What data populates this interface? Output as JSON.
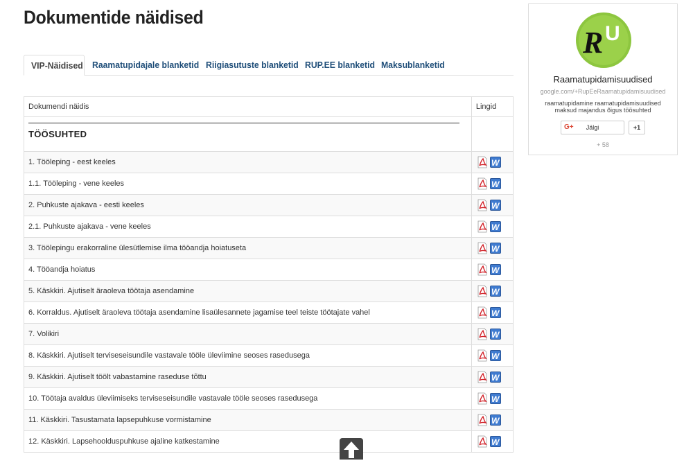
{
  "page": {
    "title": "Dokumentide näidised"
  },
  "tabs": [
    {
      "label": "VIP-Näidised",
      "active": true
    },
    {
      "label": "Raamatupidajale blanketid",
      "active": false
    },
    {
      "label": "Riigiasutuste blanketid",
      "active": false
    },
    {
      "label": "RUP.EE blanketid",
      "active": false
    },
    {
      "label": "Maksublanketid",
      "active": false
    }
  ],
  "table": {
    "headers": {
      "document": "Dokumendi näidis",
      "links": "Lingid"
    },
    "section_title": "TÖÖSUHTED",
    "rows": [
      "1. Tööleping - eest keeles",
      "1.1. Tööleping - vene keeles",
      "2. Puhkuste ajakava - eesti keeles",
      "2.1. Puhkuste ajakava - vene keeles",
      "3. Töölepingu erakorraline ülesütlemise ilma tööandja hoiatuseta",
      "4. Tööandja hoiatus",
      "5. Käskkiri. Ajutiselt äraoleva töötaja asendamine",
      "6. Korraldus. Ajutiselt äraoleva töötaja asendamine lisaülesannete jagamise teel teiste töötajate vahel",
      "7. Volikiri",
      "8. Käskkiri. Ajutiselt terviseseisundile vastavale tööle üleviimine seoses rasedusega",
      "9. Käskkiri. Ajutiselt töölt vabastamine raseduse tõttu",
      "10. Töötaja avaldus üleviimiseks terviseseisundile vastavale tööle seoses rasedusega",
      "11. Käskkiri. Tasustamata lapsepuhkuse vormistamine",
      "12. Käskkiri. Lapsehoolduspuhkuse ajaline katkestamine"
    ],
    "link_icons": [
      "pdf-icon",
      "word-icon"
    ]
  },
  "widget": {
    "logo_text": "RU",
    "name": "Raamatupidamisuudised",
    "url": "google.com/+RupEeRaamatupidamisuudised",
    "description": "raamatupidamine raamatupidamisuudised maksud majandus õigus töösuhted",
    "follow_label": "Jälgi",
    "plus_one_label": "+1",
    "follower_count": "+ 58",
    "brand_color": "#8dc63f"
  },
  "colors": {
    "tab_link": "#1f4e79",
    "border": "#dddddd"
  }
}
